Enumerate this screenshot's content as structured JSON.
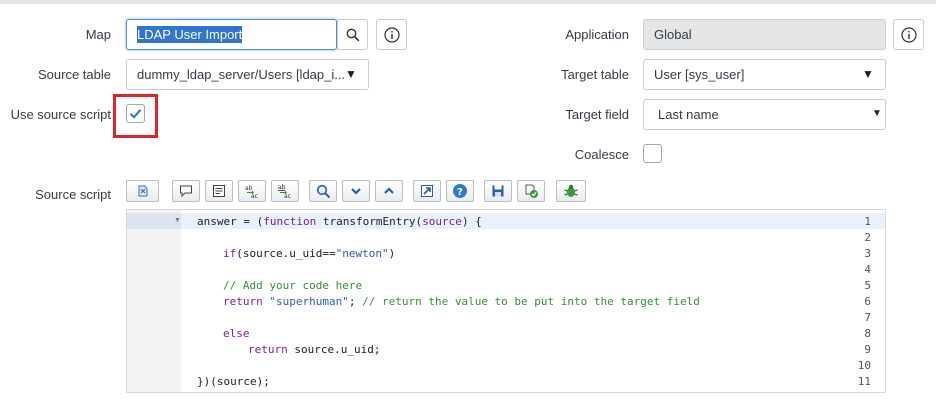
{
  "form": {
    "map_label": "Map",
    "map_value": "LDAP User Import",
    "source_table_label": "Source table",
    "source_table_value": "dummy_ldap_server/Users [ldap_i...",
    "use_source_script_label": "Use source script",
    "use_source_script_checked": true,
    "application_label": "Application",
    "application_value": "Global",
    "target_table_label": "Target table",
    "target_table_value": "User [sys_user]",
    "target_field_label": "Target field",
    "target_field_value": "Last name",
    "coalesce_label": "Coalesce",
    "coalesce_checked": false,
    "source_script_label": "Source script"
  },
  "toolbar": {
    "buttons": [
      "script-include-icon",
      "comment-icon",
      "format-icon",
      "replace-icon",
      "replace-all-icon",
      "search-icon",
      "fold-down-icon",
      "fold-up-icon",
      "fullscreen-icon",
      "help-icon",
      "save-icon",
      "check-syntax-icon",
      "debug-icon"
    ]
  },
  "editor": {
    "line_numbers": [
      "1",
      "2",
      "3",
      "4",
      "5",
      "6",
      "7",
      "8",
      "9",
      "10",
      "11"
    ],
    "lines": {
      "l1_a": "answer = (",
      "l1_kw": "function",
      "l1_b": " transformEntry(",
      "l1_c": "source",
      "l1_d": ") {",
      "l3_kw": "if",
      "l3_a": "(source.u_uid==",
      "l3_str": "\"newton\"",
      "l3_b": ")",
      "l5_cm": "// Add your code here",
      "l6_kw": "return",
      "l6_sp": " ",
      "l6_str": "\"superhuman\"",
      "l6_a": "; ",
      "l6_cm": "// return the value to be put into the target field",
      "l8_kw": "else",
      "l9_kw": "return",
      "l9_a": " source.u_uid;",
      "l11": "})(source);"
    }
  },
  "colors": {
    "highlight_box": "#e2242b",
    "selection": "#3274d1",
    "focus_border": "#4f8cd2",
    "checkmark": "#2e6fc6"
  }
}
